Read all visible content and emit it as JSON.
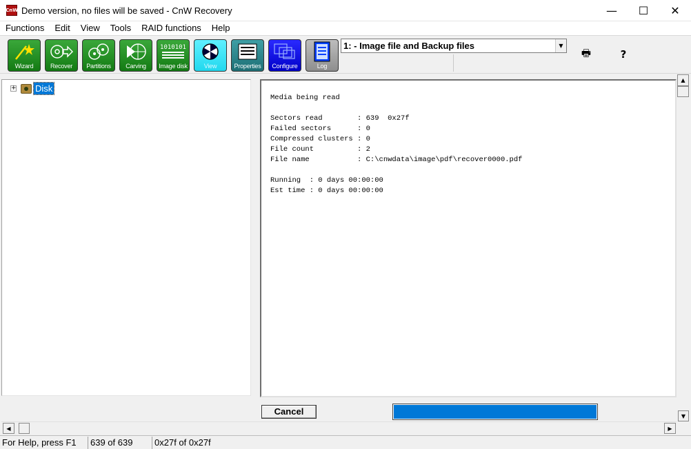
{
  "window": {
    "app_icon_text": "CnW",
    "title": "Demo version, no files will be saved - CnW Recovery",
    "minimize": "—",
    "maximize": "☐",
    "close": "✕"
  },
  "menu": [
    "Functions",
    "Edit",
    "View",
    "Tools",
    "RAID functions",
    "Help"
  ],
  "toolbar": {
    "buttons": [
      {
        "label": "Wizard",
        "icon": "wand-icon",
        "color": "#1e8c1e"
      },
      {
        "label": "Recover",
        "icon": "recover-icon",
        "color": "#1e8c1e"
      },
      {
        "label": "Partitions",
        "icon": "partitions-icon",
        "color": "#1e8c1e"
      },
      {
        "label": "Carving",
        "icon": "carving-icon",
        "color": "#1e8c1e"
      },
      {
        "label": "Image disk",
        "icon": "binary-icon",
        "color": "#1e8c1e"
      },
      {
        "label": "View",
        "icon": "view-icon",
        "color": "#2fe0f2"
      },
      {
        "label": "Properties",
        "icon": "properties-icon",
        "color": "#2a8085"
      },
      {
        "label": "Configure",
        "icon": "configure-icon",
        "color": "#0000dd"
      },
      {
        "label": "Log",
        "icon": "log-icon",
        "color": "#a8a8a8"
      }
    ],
    "combo_value": "1: - Image file and Backup files",
    "combo_arrow": "▼",
    "print_icon": "🖶",
    "help_icon": "?"
  },
  "tree": {
    "expander": "+",
    "root_label": "Disk"
  },
  "log": {
    "lines": [
      "Media being read",
      "",
      "Sectors read        : 639  0x27f",
      "Failed sectors      : 0",
      "Compressed clusters : 0",
      "File count          : 2",
      "File name           : C:\\cnwdata\\image\\pdf\\recover0000.pdf",
      "",
      "Running  : 0 days 00:00:00",
      "Est time : 0 days 00:00:00"
    ]
  },
  "controls": {
    "cancel_label": "Cancel",
    "progress_fraction": 1.0,
    "progress_color": "#0078d7"
  },
  "scroll": {
    "up": "▲",
    "down": "▼",
    "left": "◀",
    "right": "▶"
  },
  "status": {
    "help": "For Help, press F1",
    "sectors": "639 of 639",
    "hex": "0x27f of 0x27f"
  }
}
